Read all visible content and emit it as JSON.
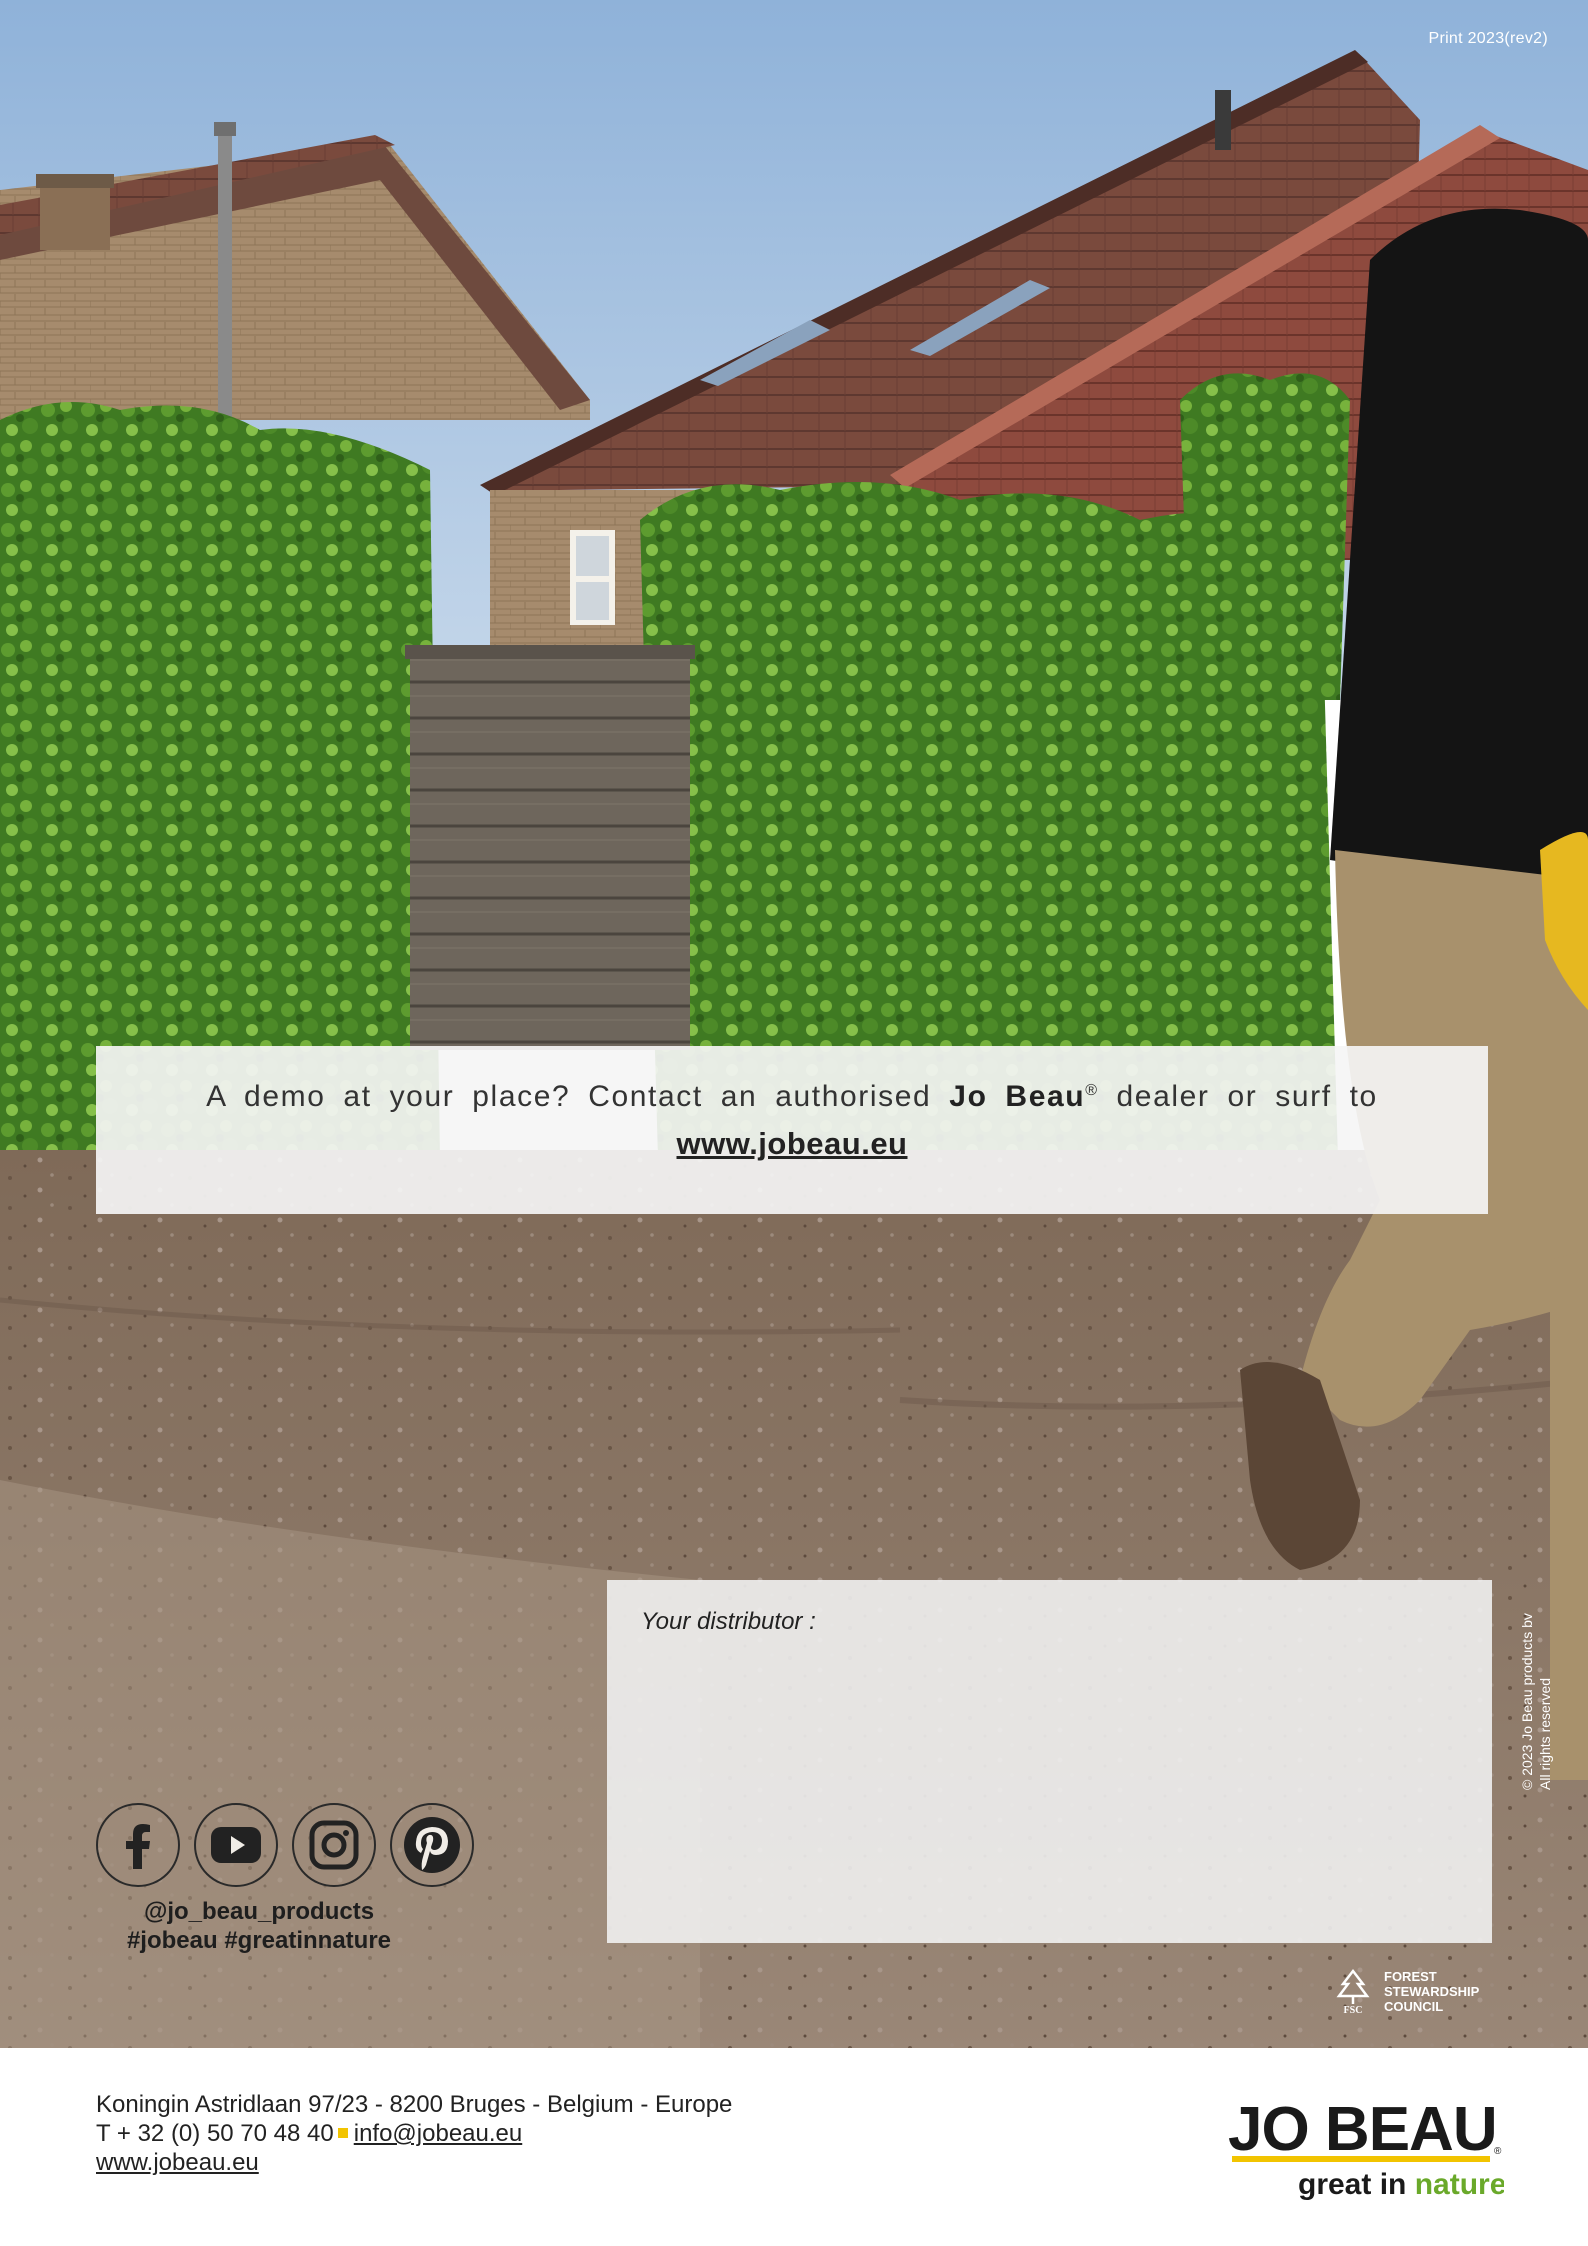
{
  "print_note": "Print 2023(rev2)",
  "demo": {
    "line_start": "A demo at your place? Contact an authorised ",
    "brand": "Jo Beau",
    "reg_mark": "®",
    "line_end": " dealer or surf to",
    "url": "www.jobeau.eu"
  },
  "distributor": {
    "label": "Your distributor :"
  },
  "copyright": {
    "line1": "© 2023 Jo Beau products bv",
    "line2": "All rights reserved"
  },
  "social": {
    "icons": [
      "facebook-icon",
      "youtube-icon",
      "instagram-icon",
      "pinterest-icon"
    ],
    "handle": "@jo_beau_products",
    "hashtags": "#jobeau #greatinnature"
  },
  "fsc": {
    "line1": "FOREST",
    "line2": "STEWARDSHIP",
    "line3": "COUNCIL",
    "mark": "FSC"
  },
  "footer": {
    "address": "Koningin Astridlaan 97/23 - 8200 Bruges - Belgium - Europe",
    "phone": "T + 32 (0) 50 70 48 40",
    "email": "info@jobeau.eu",
    "website": "www.jobeau.eu"
  },
  "logo": {
    "brand": "JO BEAU",
    "reg_mark": "®",
    "tagline_start": "great in ",
    "tagline_end": "nature",
    "tm_mark": "™"
  },
  "colors": {
    "brand_yellow": "#f2c400",
    "brand_green": "#6aa92a",
    "text_dark": "#222222"
  }
}
